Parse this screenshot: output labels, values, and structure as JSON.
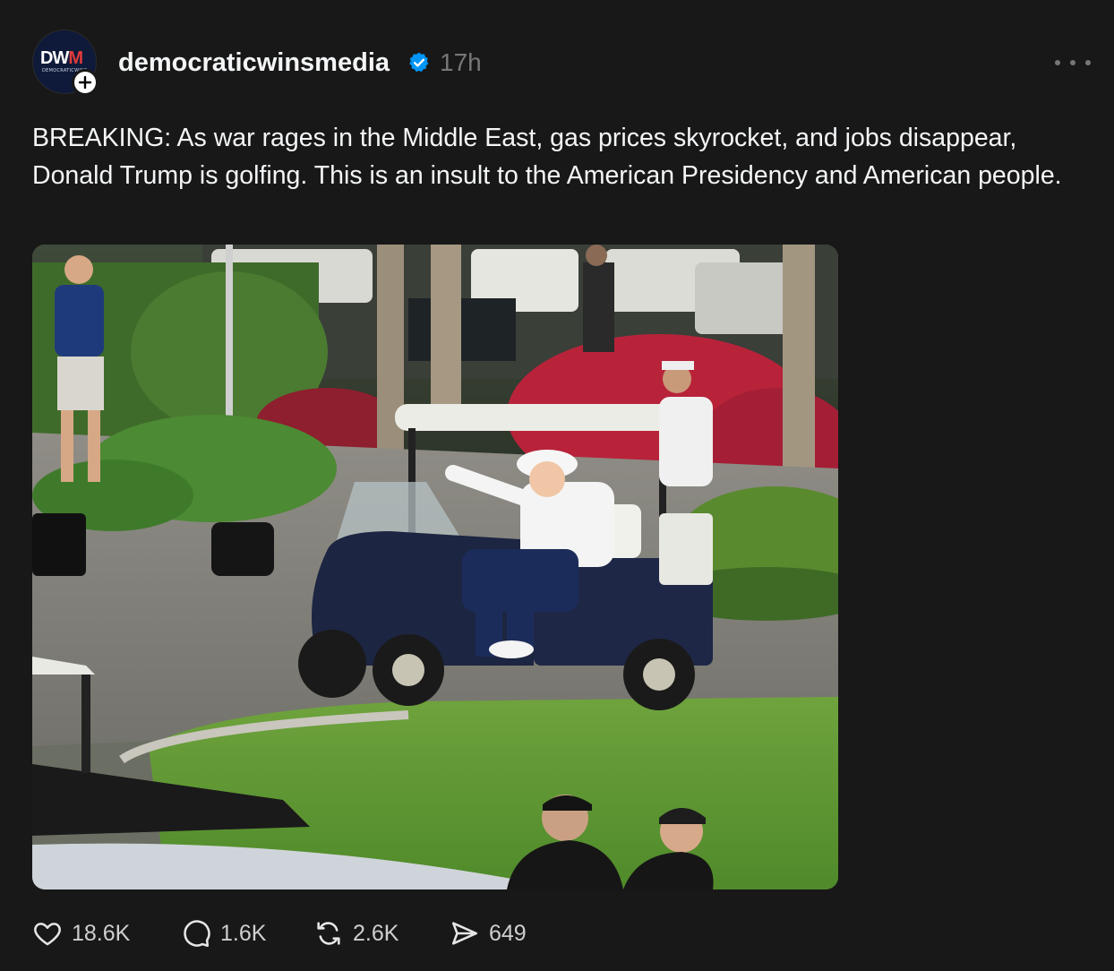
{
  "post": {
    "author": {
      "username": "democraticwinsmedia",
      "verified": true,
      "avatar_text": "DWM",
      "avatar_subtext": "DEMOCRATICWINS",
      "follow_icon": "plus-icon"
    },
    "timestamp": "17h",
    "more_icon": "ellipsis-icon",
    "caption": "BREAKING: As war rages in the Middle East, gas prices skyrocket, and jobs disappear, Donald Trump is golfing. This is an insult to the American Presidency and American people.",
    "image": {
      "subject": "photo"
    },
    "actions": {
      "likes": "18.6K",
      "replies": "1.6K",
      "reposts": "2.6K",
      "shares": "649"
    }
  },
  "colors": {
    "background": "#181818",
    "text": "#f3f5f7",
    "muted": "#777777",
    "verified": "#0095f6"
  }
}
